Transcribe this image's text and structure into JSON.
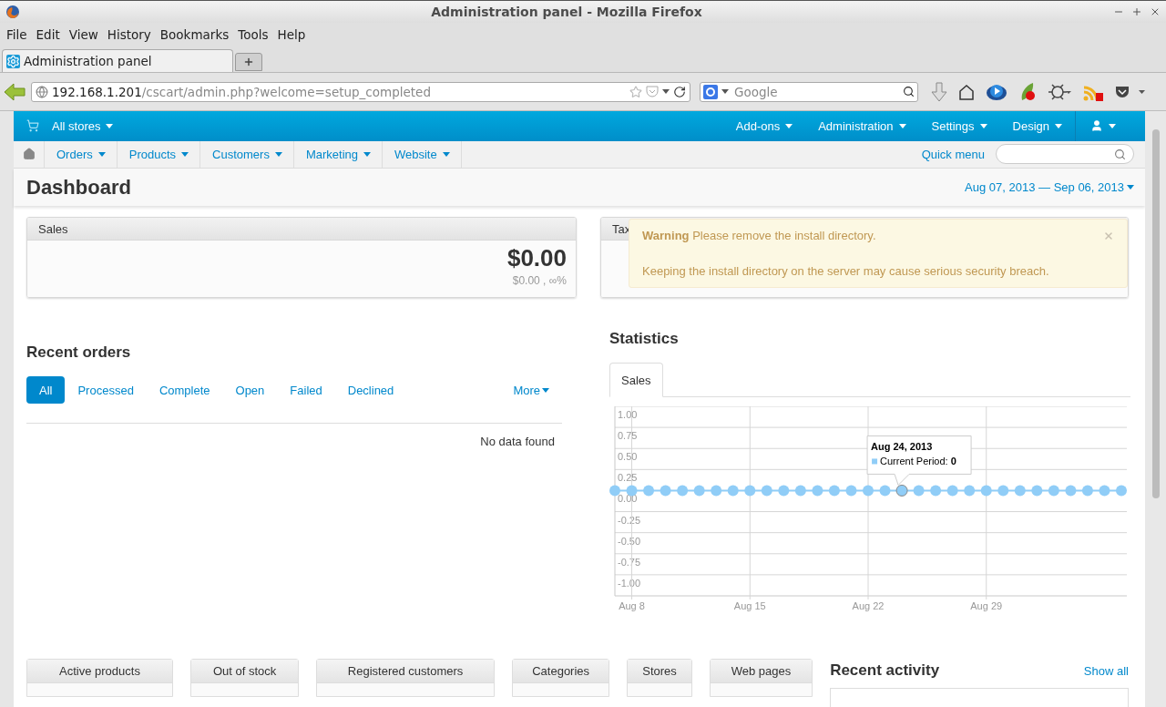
{
  "window": {
    "title": "Administration panel - Mozilla Firefox"
  },
  "menu": [
    "File",
    "Edit",
    "View",
    "History",
    "Bookmarks",
    "Tools",
    "Help"
  ],
  "tabs": [
    {
      "label": "Administration panel",
      "selected": true
    }
  ],
  "address_bar": {
    "host": "192.168.1.201",
    "path": "/cscart/admin.php?welcome=setup_completed"
  },
  "search": {
    "placeholder": "Google"
  },
  "admin": {
    "store_menu": "All stores",
    "top_menu": [
      "Add-ons",
      "Administration",
      "Settings",
      "Design"
    ],
    "nav": [
      "Orders",
      "Products",
      "Customers",
      "Marketing",
      "Website"
    ],
    "quick_menu": "Quick menu",
    "page_title": "Dashboard",
    "date_range": "Aug 07, 2013 — Sep 06, 2013",
    "cards": [
      {
        "title": "Sales",
        "value": "$0.00",
        "detail": "$0.00 , ∞%"
      },
      {
        "title": "Tax"
      }
    ],
    "warning": {
      "title": "Warning",
      "message": "Please remove the install directory.",
      "detail": "Keeping the install directory on the server may cause serious security breach."
    },
    "recent_orders": {
      "title": "Recent orders",
      "filters": [
        {
          "label": "All",
          "selected": true
        },
        {
          "label": "Processed",
          "selected": false
        },
        {
          "label": "Complete",
          "selected": false
        },
        {
          "label": "Open",
          "selected": false
        },
        {
          "label": "Failed",
          "selected": false
        },
        {
          "label": "Declined",
          "selected": false
        }
      ],
      "more": "More",
      "empty": "No data found"
    },
    "statistics": {
      "title": "Statistics",
      "tabs": [
        {
          "label": "Sales",
          "selected": true
        }
      ],
      "tooltip": {
        "date": "Aug 24, 2013",
        "separator": ":",
        "value": "0"
      },
      "chart_data": {
        "type": "line",
        "categories": [
          null,
          "Aug 8",
          null,
          null,
          null,
          null,
          null,
          null,
          "Aug 15",
          null,
          null,
          null,
          null,
          null,
          null,
          "Aug 22",
          null,
          null,
          null,
          null,
          null,
          null,
          "Aug 29",
          null,
          null,
          null,
          null,
          null,
          null,
          null,
          null
        ],
        "grid": true,
        "series": [
          {
            "name": "Current Period",
            "color": "#90cdf7",
            "marker": "circle",
            "values": [
              0,
              0,
              0,
              0,
              0,
              0,
              0,
              0,
              0,
              0,
              0,
              0,
              0,
              0,
              0,
              0,
              0,
              0,
              0,
              0,
              0,
              0,
              0,
              0,
              0,
              0,
              0,
              0,
              0,
              0,
              0
            ]
          }
        ],
        "ylim": [
          -1.25,
          1
        ],
        "yticks": [
          {
            "value": 1,
            "label": "1.00"
          },
          {
            "value": 0.75,
            "label": "0.75"
          },
          {
            "value": 0.5,
            "label": "0.50"
          },
          {
            "value": 0.25,
            "label": "0.25"
          },
          {
            "value": 0,
            "label": "0.00"
          },
          {
            "value": -0.25,
            "label": "-0.25"
          },
          {
            "value": -0.5,
            "label": "-0.50"
          },
          {
            "value": -0.75,
            "label": "-0.75"
          },
          {
            "value": -1,
            "label": "-1.00"
          }
        ]
      }
    },
    "summary_tabs": [
      "Active products",
      "Out of stock",
      "Registered customers",
      "Categories",
      "Stores",
      "Web pages"
    ],
    "recent_activity": {
      "title": "Recent activity",
      "link": "Show all"
    }
  }
}
